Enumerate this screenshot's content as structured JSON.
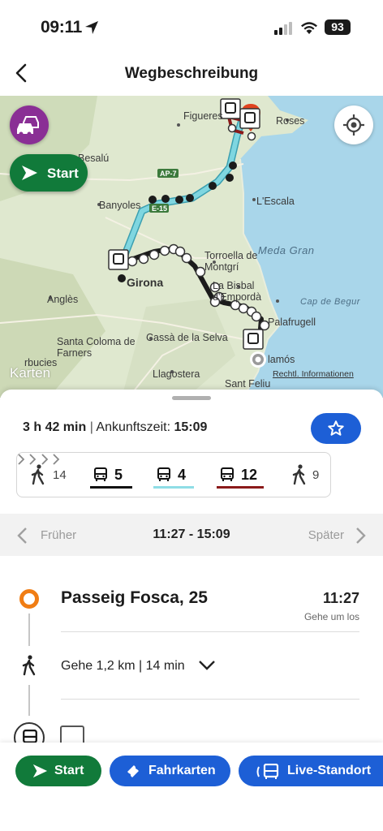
{
  "status": {
    "time": "09:11",
    "battery": "93"
  },
  "header": {
    "title": "Wegbeschreibung"
  },
  "map": {
    "labels": {
      "figueres": "Figueres",
      "roses": "Roses",
      "besalu": "Besalú",
      "ap7": "AP-7",
      "banyoles": "Banyoles",
      "e15": "E-15",
      "lescala": "L'Escala",
      "torroella": "Torroella de Montgrí",
      "medagran": "Meda Gran",
      "girona": "Girona",
      "labisbal": "La Bisbal d'Empordà",
      "capdebegur": "Cap de Begur",
      "angles": "Anglès",
      "palafrugell": "Palafrugell",
      "santacoloma": "Santa Coloma de Farners",
      "cassa": "Cassà de la Selva",
      "palamos": "lamós",
      "llagostera": "Llagostera",
      "santfeliu": "Sant Feliu",
      "arbucies": "rbucies"
    },
    "start_label": "Start",
    "brand": "Karten",
    "legal": "Rechtl. Informationen",
    "route_color": "#7fd6e0",
    "bus_color": "#222222",
    "accent_red": "#e0431f"
  },
  "sheet": {
    "duration": "3 h 42 min",
    "arrival_label": "Ankunftszeit:",
    "arrival_time": "15:09",
    "legs": {
      "walk1": "14",
      "bus1": "5",
      "bus2": "4",
      "bus3": "12",
      "walk2": "9"
    },
    "leg_colors": {
      "bus1": "#111111",
      "bus2": "#8fdde6",
      "bus3": "#8b1a1a"
    },
    "time_nav": {
      "earlier": "Früher",
      "range": "11:27 - 15:09",
      "later": "Später"
    },
    "stop1": {
      "name": "Passeig Fosca, 25",
      "time": "11:27",
      "note": "Gehe um los"
    },
    "walk": {
      "text": "Gehe 1,2 km | 14 min"
    }
  },
  "bottom": {
    "start": "Start",
    "tickets": "Fahrkarten",
    "live": "Live-Standort",
    "green": "#117a3a",
    "blue": "#1d5fd6"
  }
}
